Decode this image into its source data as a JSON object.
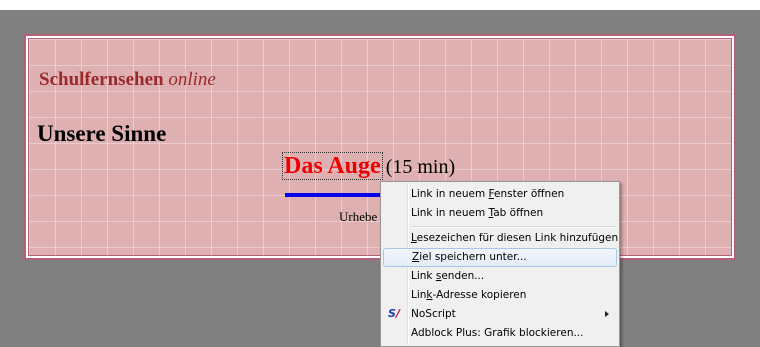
{
  "page": {
    "brand_bold": "Schulfernsehen",
    "brand_italic": "online",
    "subject": "Unsere Sinne",
    "video_title": "Das Auge",
    "video_duration": "(15 min)",
    "credit_partial": "Urhebe",
    "colors": {
      "background": "#808080",
      "panel": "#dfb0b2",
      "frame_border": "#b5607a",
      "brand": "#9a2a2a",
      "title_link": "#ee0000",
      "progress_bar": "#0000ee"
    }
  },
  "context_menu": {
    "items": [
      {
        "pre": "Link in neuem ",
        "key": "F",
        "post": "enster öffnen"
      },
      {
        "pre": "Link in neuem ",
        "key": "T",
        "post": "ab öffnen"
      },
      {
        "pre": "",
        "key": "L",
        "post": "esezeichen für diesen Link hinzufügen"
      },
      {
        "pre": "",
        "key": "Z",
        "post": "iel speichern unter..."
      },
      {
        "pre": "Link ",
        "key": "s",
        "post": "enden..."
      },
      {
        "pre": "Lin",
        "key": "k",
        "post": "-Adresse kopieren"
      },
      {
        "pre": "",
        "key": "",
        "post": "NoScript",
        "icon": "noscript-icon",
        "has_submenu": true
      },
      {
        "pre": "",
        "key": "",
        "post": "Adblock Plus: Grafik blockieren..."
      }
    ],
    "noscript_icon_text": "S",
    "noscript_icon_slash": "/",
    "highlighted_index": 3
  }
}
